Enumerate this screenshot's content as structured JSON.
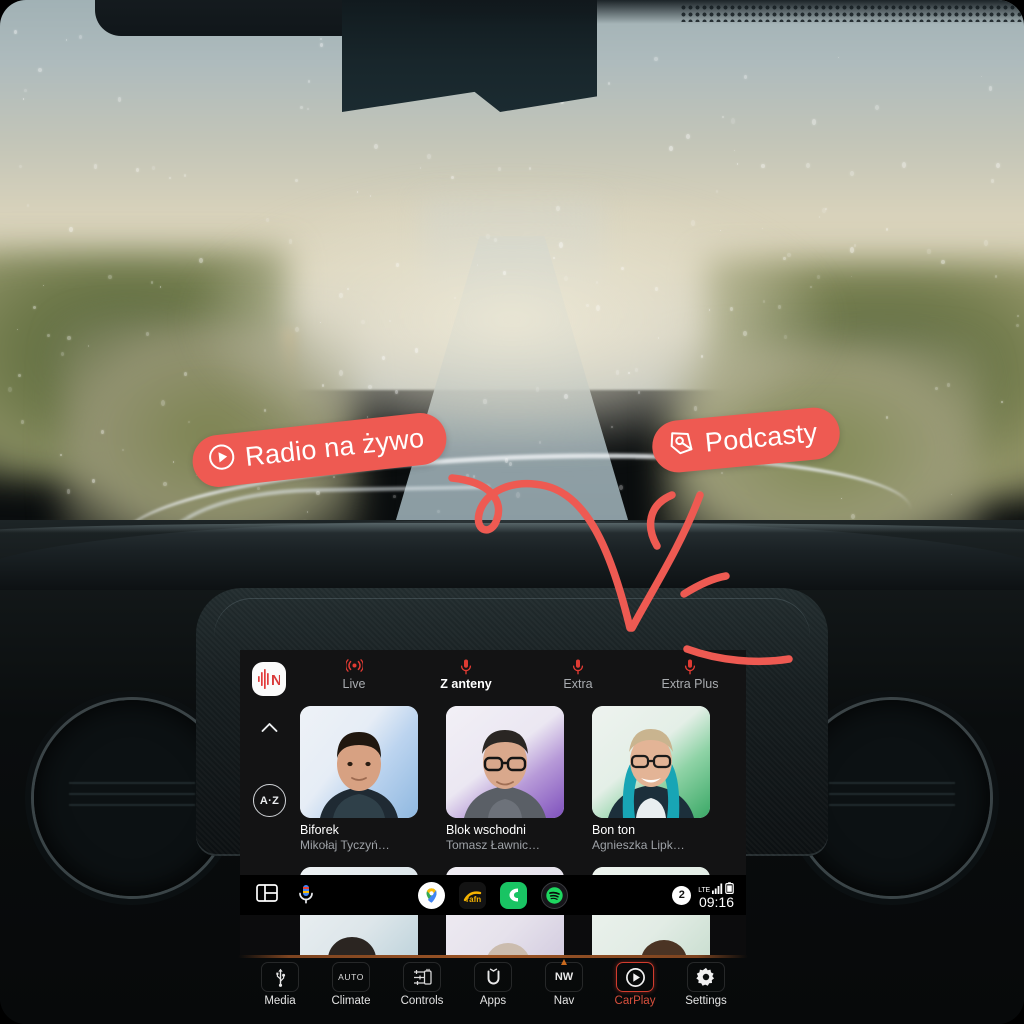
{
  "scene": {
    "description": "blurred rainy road seen through car windshield",
    "mirror": "rear-view-mirror-housing",
    "wiper": "windshield-wiper-blade"
  },
  "annotations": [
    {
      "id": "radio-na-zywo",
      "label": "Radio na żywo",
      "icon": "play-circle-icon",
      "color": "#ee5a52"
    },
    {
      "id": "podcasty",
      "label": "Podcasty",
      "icon": "pen-nib-icon",
      "color": "#ee5a52"
    }
  ],
  "infotainment": {
    "app": {
      "logo_icon": "radio-waveform-n-logo",
      "rail": {
        "scroll_up_icon": "chevron-up-icon",
        "scroll_down_icon": "chevron-down-icon",
        "sort_label": "A·Z"
      },
      "tabs": [
        {
          "label": "Live",
          "icon": "broadcast-icon",
          "active": false
        },
        {
          "label": "Z anteny",
          "icon": "microphone-icon",
          "active": true
        },
        {
          "label": "Extra",
          "icon": "microphone-icon",
          "active": false
        },
        {
          "label": "Extra Plus",
          "icon": "microphone-icon",
          "active": false
        }
      ],
      "cards": [
        {
          "title": "Biforek",
          "author": "Mikołaj Tyczyń…",
          "accent": "#bcd4ef"
        },
        {
          "title": "Blok wschodni",
          "author": "Tomasz Ławnic…",
          "accent": "#9b6fd0"
        },
        {
          "title": "Bon ton",
          "author": "Agnieszka Lipk…",
          "accent": "#5bbf7a"
        }
      ]
    },
    "taskbar": {
      "split_screen_icon": "split-screen-icon",
      "mic_icon": "google-assistant-mic-icon",
      "apps": [
        {
          "name": "google-maps-icon",
          "color": "#ffffff"
        },
        {
          "name": "radio-app-icon",
          "color": "#f2b300"
        },
        {
          "name": "phone-icon",
          "color": "#1bd760"
        },
        {
          "name": "spotify-icon",
          "color": "#1ed760"
        }
      ],
      "notification_count": "2",
      "network_label": "LTE",
      "signal_icon": "signal-bars-icon",
      "battery_icon": "battery-icon",
      "clock": "09:16"
    },
    "hardware_buttons": [
      {
        "label": "Media",
        "icon": "usb-icon",
        "active": false
      },
      {
        "label": "Climate",
        "icon": "auto-text",
        "active": false
      },
      {
        "label": "Controls",
        "icon": "sliders-icon",
        "active": false
      },
      {
        "label": "Apps",
        "icon": "uconnect-icon",
        "active": false
      },
      {
        "label": "Nav",
        "icon": "compass-nw",
        "active": false
      },
      {
        "label": "CarPlay",
        "icon": "carplay-icon",
        "active": true
      },
      {
        "label": "Settings",
        "icon": "gear-icon",
        "active": false
      }
    ]
  }
}
